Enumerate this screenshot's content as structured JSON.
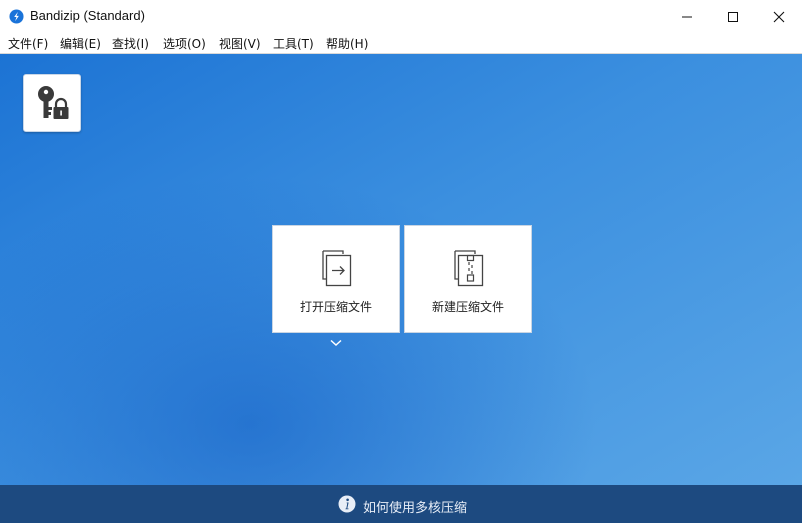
{
  "window": {
    "title": "Bandizip (Standard)",
    "controls": [
      "minimize-icon",
      "maximize-icon",
      "close-icon"
    ]
  },
  "menu": [
    {
      "label": "文件(F)"
    },
    {
      "label": "编辑(E)"
    },
    {
      "label": "查找(I)"
    },
    {
      "label": "选项(O)"
    },
    {
      "label": "视图(V)"
    },
    {
      "label": "工具(T)"
    },
    {
      "label": "帮助(H)"
    }
  ],
  "main": {
    "lock_button_icon": "key-lock-icon",
    "tiles": [
      {
        "label": "打开压缩文件",
        "icon": "open-archive-icon"
      },
      {
        "label": "新建压缩文件",
        "icon": "new-archive-icon"
      }
    ],
    "more_icon": "chevron-down-icon"
  },
  "footer": {
    "text": "如何使用多核压缩",
    "icon": "info-icon"
  },
  "colors": {
    "accent": "#2b7fd8",
    "footer": "#1d4a80"
  }
}
